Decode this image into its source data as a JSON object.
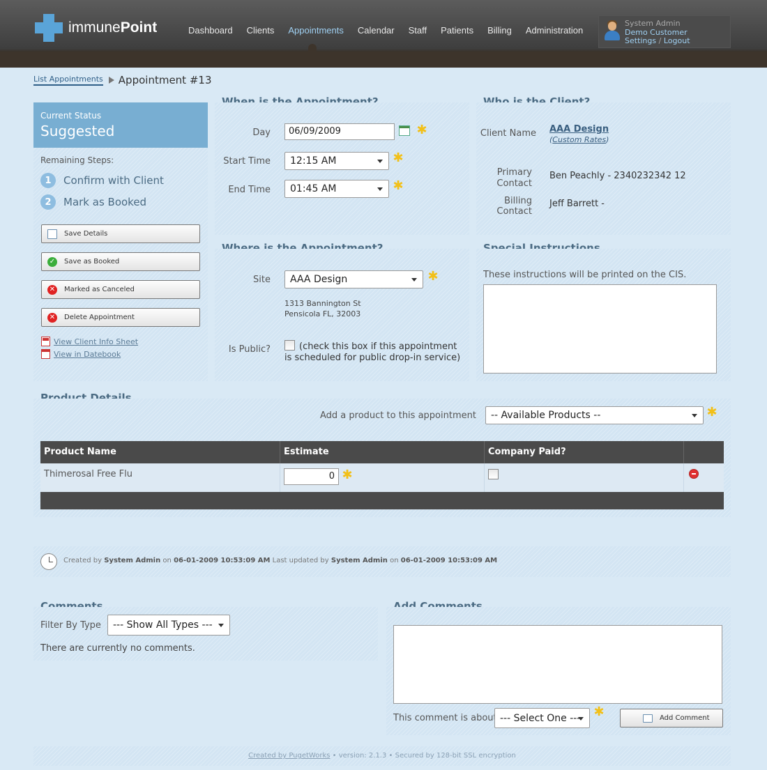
{
  "brand": {
    "name_light": "immune",
    "name_bold": "Point"
  },
  "nav": [
    "Dashboard",
    "Clients",
    "Appointments",
    "Calendar",
    "Staff",
    "Patients",
    "Billing",
    "Administration"
  ],
  "user": {
    "name": "System Admin",
    "org": "Demo Customer",
    "settings": "Settings",
    "sep": "/",
    "logout": "Logout"
  },
  "breadcrumb": {
    "link": "List Appointments",
    "title": "Appointment #13"
  },
  "status": {
    "label": "Current Status",
    "value": "Suggested",
    "remaining": "Remaining Steps:",
    "steps": [
      {
        "num": "1",
        "label": "Confirm with Client"
      },
      {
        "num": "2",
        "label": "Mark as Booked"
      }
    ],
    "buttons": [
      "Save Details",
      "Save as Booked",
      "Marked as Canceled",
      "Delete Appointment"
    ],
    "links": [
      "View Client Info Sheet",
      "View in Datebook"
    ]
  },
  "when": {
    "title": "When is the Appointment?",
    "day_label": "Day",
    "day_value": "06/09/2009",
    "start_label": "Start Time",
    "start_value": "12:15 AM",
    "end_label": "End Time",
    "end_value": "01:45 AM"
  },
  "who": {
    "title": "Who is the Client?",
    "client_label": "Client Name",
    "client_name": "AAA Design",
    "rates": "Custom Rates",
    "primary_label_1": "Primary",
    "primary_label_2": "Contact",
    "primary_value": "Ben Peachly - 2340232342 12",
    "billing_label_1": "Billing",
    "billing_label_2": "Contact",
    "billing_value": "Jeff Barrett -"
  },
  "where": {
    "title": "Where is the Appointment?",
    "site_label": "Site",
    "site_value": "AAA Design",
    "addr1": "1313 Bannington St",
    "addr2": "Pensicola FL, 32003",
    "public_label": "Is Public?",
    "public_note": "(check this box if this appointment is scheduled for public drop-in service)"
  },
  "special": {
    "title": "Special Instructions",
    "info": "These instructions will be printed on the CIS."
  },
  "products": {
    "title": "Product Details",
    "add_label": "Add a product to this appointment",
    "select_value": "-- Available Products --",
    "columns": [
      "Product Name",
      "Estimate",
      "Company Paid?"
    ],
    "rows": [
      {
        "name": "Thimerosal Free Flu",
        "estimate": "0"
      }
    ]
  },
  "audit": {
    "created_by_label": "Created by",
    "created_by": "System Admin",
    "on1": "on",
    "created_at": "06-01-2009 10:53:09 AM",
    "updated_label": "Last updated by",
    "updated_by": "System Admin",
    "on2": "on",
    "updated_at": "06-01-2009 10:53:09 AM"
  },
  "comments": {
    "title": "Comments",
    "filter_label": "Filter By Type",
    "filter_value": "--- Show All Types ---",
    "none": "There are currently no comments."
  },
  "add_comments": {
    "title": "Add Comments",
    "about_label": "This comment is about",
    "about_value": "--- Select One ---",
    "button": "Add Comment"
  },
  "footer": {
    "created": "Created by PugetWorks",
    "rest": "• version: 2.1.3 • Secured by 128-bit SSL encryption"
  },
  "colors": {
    "accent": "#5aa4d8",
    "status_head": "#78aed2",
    "header": "#4a4a4a"
  }
}
